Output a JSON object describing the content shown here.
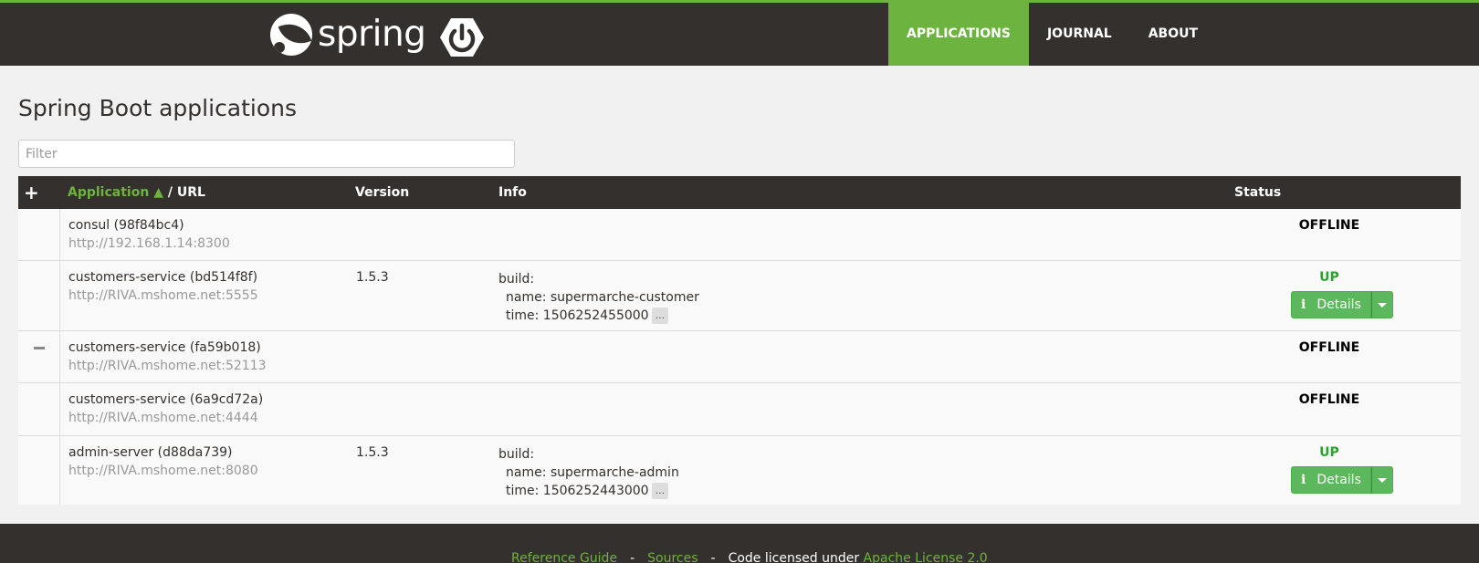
{
  "brand": {
    "name": "spring"
  },
  "nav": {
    "items": [
      "APPLICATIONS",
      "JOURNAL",
      "ABOUT"
    ],
    "active": "APPLICATIONS"
  },
  "page": {
    "title": "Spring Boot applications"
  },
  "filter": {
    "placeholder": "Filter",
    "value": ""
  },
  "table": {
    "headers": {
      "expand": "+",
      "application": "Application",
      "sort": "▲",
      "url": "/ URL",
      "version": "Version",
      "info": "Info",
      "status": "Status"
    },
    "collapse": "−",
    "rows": [
      {
        "name": "consul (98f84bc4)",
        "url": "http://192.168.1.14:8300",
        "version": "",
        "info": null,
        "status": "OFFLINE"
      },
      {
        "name": "customers-service (bd514f8f)",
        "url": "http://RIVA.mshome.net:5555",
        "version": "1.5.3",
        "info": {
          "build": "build:",
          "name": "name: supermarche-customer",
          "time": "time: 1506252455000"
        },
        "status": "UP",
        "details": "Details"
      },
      {
        "name": "customers-service (fa59b018)",
        "url": "http://RIVA.mshome.net:52113",
        "version": "",
        "info": null,
        "status": "OFFLINE"
      },
      {
        "name": "customers-service (6a9cd72a)",
        "url": "http://RIVA.mshome.net:4444",
        "version": "",
        "info": null,
        "status": "OFFLINE"
      },
      {
        "name": "admin-server (d88da739)",
        "url": "http://RIVA.mshome.net:8080",
        "version": "1.5.3",
        "info": {
          "build": "build:",
          "name": "name: supermarche-admin",
          "time": "time: 1506252443000"
        },
        "status": "UP",
        "details": "Details"
      }
    ],
    "ellipsis": "..."
  },
  "footer": {
    "reference": "Reference Guide",
    "sources": "Sources",
    "dash": "-",
    "licensed": "Code licensed under",
    "license": "Apache License 2.0"
  },
  "colors": {
    "brand_green": "#6db33f",
    "dark": "#34302d",
    "up": "#2ba32b",
    "button": "#5cb85c"
  }
}
